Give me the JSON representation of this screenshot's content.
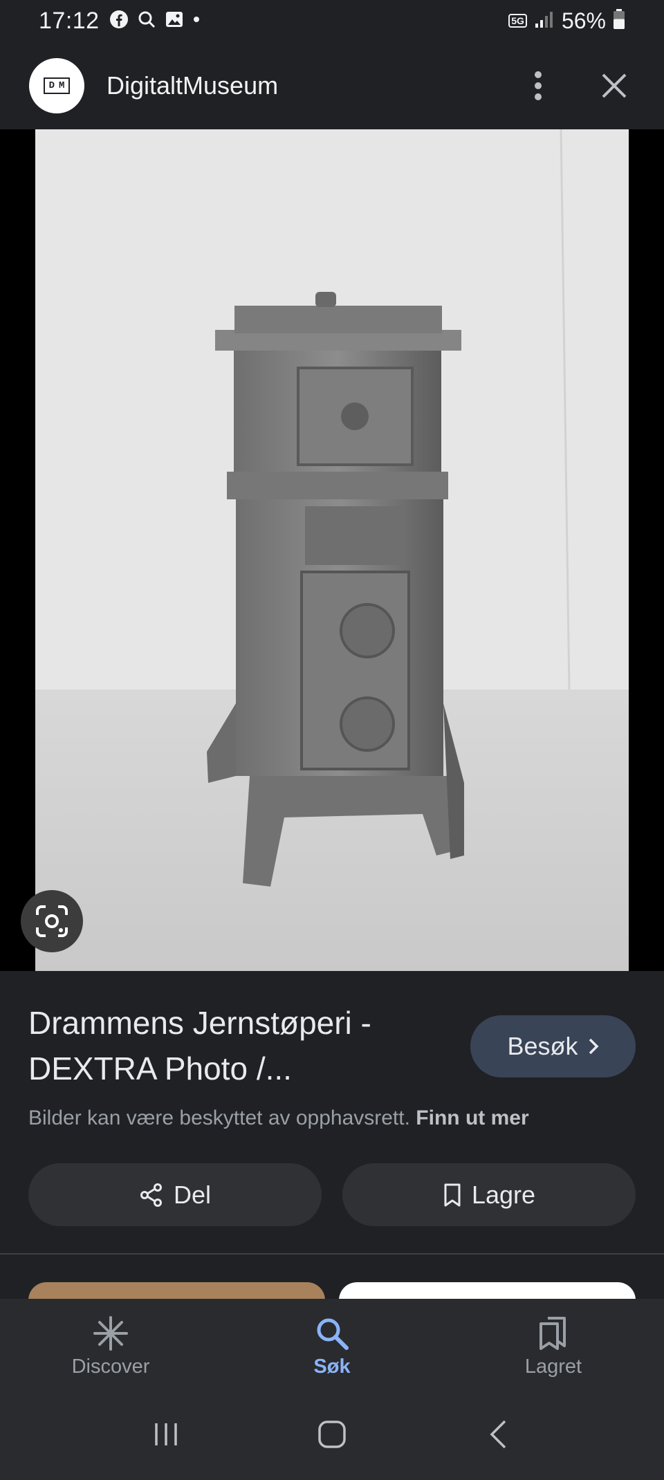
{
  "status_bar": {
    "time": "17:12",
    "network": "5G",
    "battery_percent": "56%",
    "battery_level": 0.56
  },
  "app_bar": {
    "logo_letters": [
      "D",
      "M"
    ],
    "site_name": "DigitaltMuseum"
  },
  "result": {
    "title": "Drammens Jernstøperi - DEXTRA Photo /...",
    "visit_label": "Besøk",
    "copyright_text": "Bilder kan være beskyttet av opphavsrett.",
    "learn_more": "Finn ut mer",
    "share_label": "Del",
    "save_label": "Lagre"
  },
  "bottom_nav": {
    "items": [
      {
        "label": "Discover",
        "icon": "asterisk-icon",
        "active": false
      },
      {
        "label": "Søk",
        "icon": "search-icon",
        "active": true
      },
      {
        "label": "Lagret",
        "icon": "bookmarks-icon",
        "active": false
      }
    ]
  },
  "colors": {
    "background": "#202124",
    "accent": "#8ab4f8",
    "visit_button": "#394457",
    "action_button": "#303134"
  }
}
